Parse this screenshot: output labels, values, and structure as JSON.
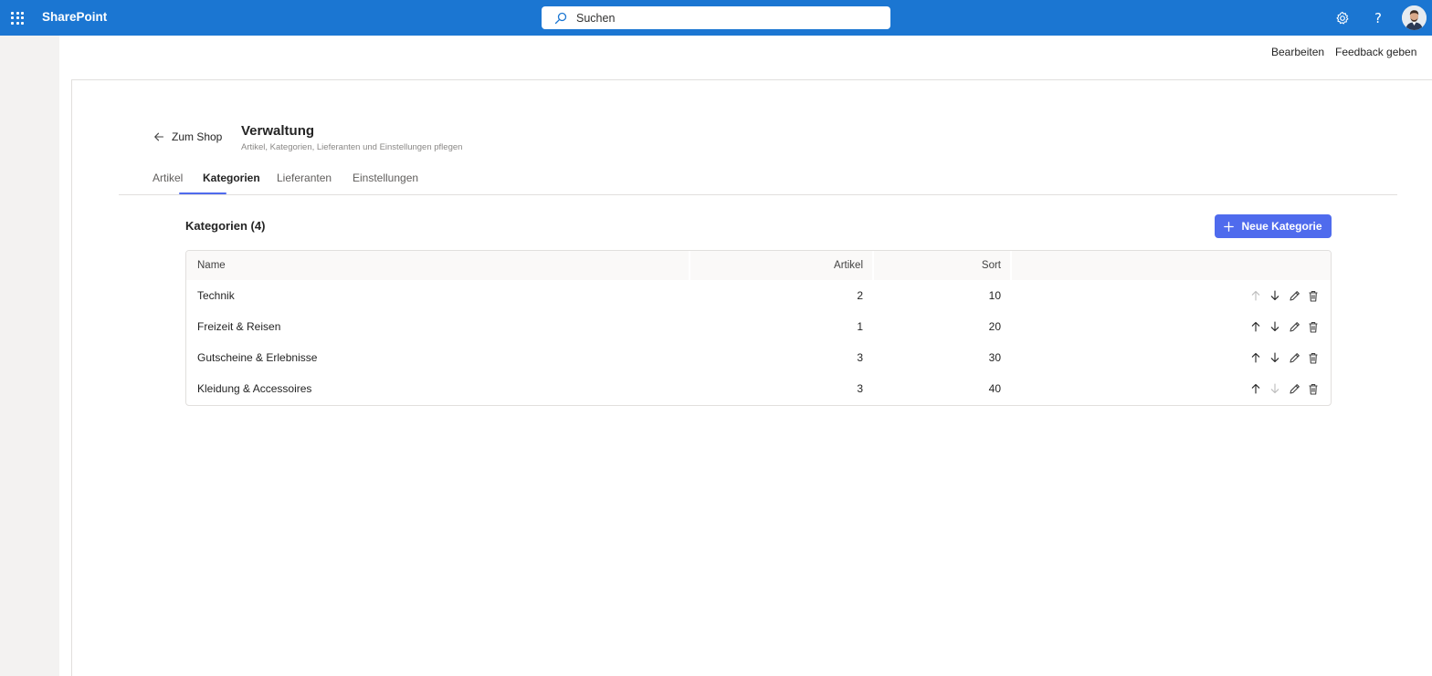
{
  "suitebar": {
    "brand": "SharePoint",
    "search_placeholder": "Suchen",
    "icons": [
      "waffle-icon",
      "search-icon",
      "gear-icon",
      "help-icon",
      "avatar"
    ],
    "help_glyph": "?"
  },
  "commandbar": {
    "edit_label": "Bearbeiten",
    "feedback_label": "Feedback geben"
  },
  "header": {
    "back_label": "Zum Shop",
    "title": "Verwaltung",
    "subtitle": "Artikel, Kategorien, Lieferanten und Einstellungen pflegen"
  },
  "tabs": [
    {
      "label": "Artikel",
      "active": false
    },
    {
      "label": "Kategorien",
      "active": true
    },
    {
      "label": "Lieferanten",
      "active": false
    },
    {
      "label": "Einstellungen",
      "active": false
    }
  ],
  "section": {
    "title": "Kategorien (4)",
    "new_button_label": "Neue Kategorie"
  },
  "table": {
    "columns": [
      "Name",
      "Artikel",
      "Sort"
    ],
    "rows": [
      {
        "name": "Technik",
        "artikel": "2",
        "sort": "10",
        "up_enabled": false,
        "down_enabled": true
      },
      {
        "name": "Freizeit & Reisen",
        "artikel": "1",
        "sort": "20",
        "up_enabled": true,
        "down_enabled": true
      },
      {
        "name": "Gutscheine & Erlebnisse",
        "artikel": "3",
        "sort": "30",
        "up_enabled": true,
        "down_enabled": true
      },
      {
        "name": "Kleidung & Accessoires",
        "artikel": "3",
        "sort": "40",
        "up_enabled": true,
        "down_enabled": false
      }
    ]
  },
  "colors": {
    "suitebar": "#1b76d2",
    "accent": "#4f6bed",
    "left_rail": "#f3f2f1"
  }
}
